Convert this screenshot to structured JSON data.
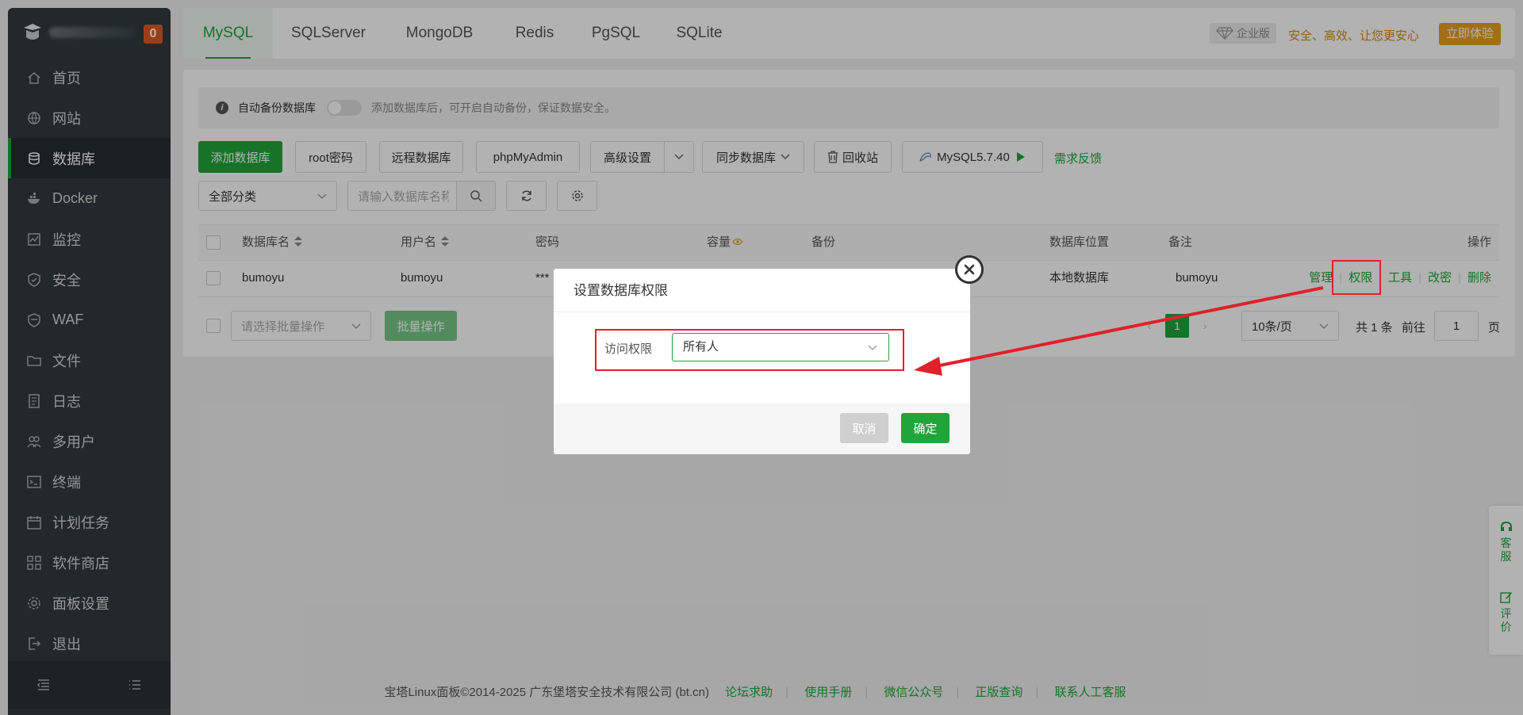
{
  "sidebar": {
    "badge": "0",
    "items": [
      {
        "label": "首页",
        "icon": "home-icon"
      },
      {
        "label": "网站",
        "icon": "globe-icon"
      },
      {
        "label": "数据库",
        "icon": "database-icon"
      },
      {
        "label": "Docker",
        "icon": "docker-icon"
      },
      {
        "label": "监控",
        "icon": "monitor-icon"
      },
      {
        "label": "安全",
        "icon": "shield-icon"
      },
      {
        "label": "WAF",
        "icon": "waf-shield-icon"
      },
      {
        "label": "文件",
        "icon": "folder-icon"
      },
      {
        "label": "日志",
        "icon": "log-icon"
      },
      {
        "label": "多用户",
        "icon": "users-icon"
      },
      {
        "label": "终端",
        "icon": "terminal-icon"
      },
      {
        "label": "计划任务",
        "icon": "calendar-icon"
      },
      {
        "label": "软件商店",
        "icon": "grid-icon"
      },
      {
        "label": "面板设置",
        "icon": "gear-icon"
      },
      {
        "label": "退出",
        "icon": "logout-icon"
      }
    ]
  },
  "tabs": [
    "MySQL",
    "SQLServer",
    "MongoDB",
    "Redis",
    "PgSQL",
    "SQLite"
  ],
  "enterprise": {
    "badge": "企业版",
    "slogan": "安全、高效、让您更安心",
    "button": "立即体验"
  },
  "notice": {
    "label": "自动备份数据库",
    "desc": "添加数据库后，可开启自动备份，保证数据安全。"
  },
  "toolbar": {
    "add": "添加数据库",
    "root_pwd": "root密码",
    "remote": "远程数据库",
    "phpmyadmin": "phpMyAdmin",
    "advanced": "高级设置",
    "sync": "同步数据库",
    "recycle": "回收站",
    "version": "MySQL5.7.40",
    "feedback": "需求反馈"
  },
  "filter": {
    "category": "全部分类",
    "search_placeholder": "请输入数据库名称"
  },
  "table": {
    "headers": {
      "name": "数据库名",
      "user": "用户名",
      "password": "密码",
      "capacity": "容量",
      "backup": "备份",
      "location": "数据库位置",
      "note": "备注",
      "ops": "操作"
    },
    "rows": [
      {
        "name": "bumoyu",
        "user": "bumoyu",
        "password": "***",
        "location": "本地数据库",
        "note": "bumoyu"
      }
    ],
    "ops": [
      "管理",
      "权限",
      "工具",
      "改密",
      "删除"
    ]
  },
  "batch": {
    "placeholder": "请选择批量操作",
    "button": "批量操作"
  },
  "pagination": {
    "current": "1",
    "per_page": "10条/页",
    "total": "共 1 条",
    "goto_label": "前往",
    "goto_value": "1",
    "page_suffix": "页"
  },
  "modal": {
    "title": "设置数据库权限",
    "field_label": "访问权限",
    "field_value": "所有人",
    "cancel": "取消",
    "confirm": "确定"
  },
  "float_widget": {
    "service": "客服",
    "review": "评价"
  },
  "footer": {
    "copyright": "宝塔Linux面板©2014-2025 广东堡塔安全技术有限公司 (bt.cn)",
    "links": [
      "论坛求助",
      "使用手册",
      "微信公众号",
      "正版查询",
      "联系人工客服"
    ]
  },
  "colors": {
    "accent": "#20a53a",
    "sidebar": "#313a3e",
    "highlight": "#e0212a"
  }
}
